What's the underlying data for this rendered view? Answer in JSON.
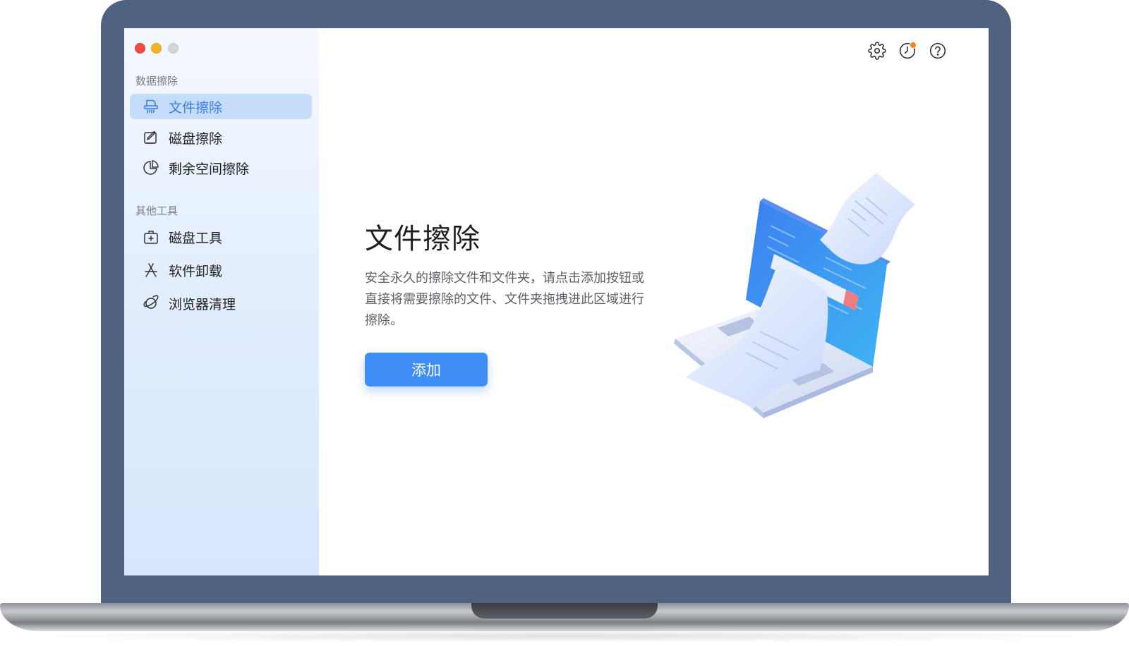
{
  "window": {
    "traffic_lights": [
      "close",
      "minimize",
      "maximize"
    ]
  },
  "sidebar": {
    "sections": [
      {
        "label": "数据擦除",
        "items": [
          {
            "label": "文件擦除",
            "icon": "file-shredder-icon",
            "active": true
          },
          {
            "label": "磁盘擦除",
            "icon": "disk-erase-icon",
            "active": false
          },
          {
            "label": "剩余空间擦除",
            "icon": "pie-chart-icon",
            "active": false
          }
        ]
      },
      {
        "label": "其他工具",
        "items": [
          {
            "label": "磁盘工具",
            "icon": "disk-tool-icon",
            "active": false
          },
          {
            "label": "软件卸载",
            "icon": "app-store-icon",
            "active": false
          },
          {
            "label": "浏览器清理",
            "icon": "planet-icon",
            "active": false
          }
        ]
      }
    ]
  },
  "toolbar": {
    "icons": [
      "gear-icon",
      "history-icon",
      "help-icon"
    ],
    "history_has_notification": true
  },
  "main": {
    "title": "文件擦除",
    "description": "安全永久的擦除文件和文件夹，请点击添加按钮或直接将需要擦除的文件、文件夹拖拽进此区域进行擦除。",
    "add_button_label": "添加"
  },
  "colors": {
    "accent": "#3f8df7",
    "active_item_bg": "#c6dcfb",
    "active_item_text": "#3a7cf0",
    "notification_dot": "#f5811f",
    "laptop_frame": "#4f6282"
  }
}
